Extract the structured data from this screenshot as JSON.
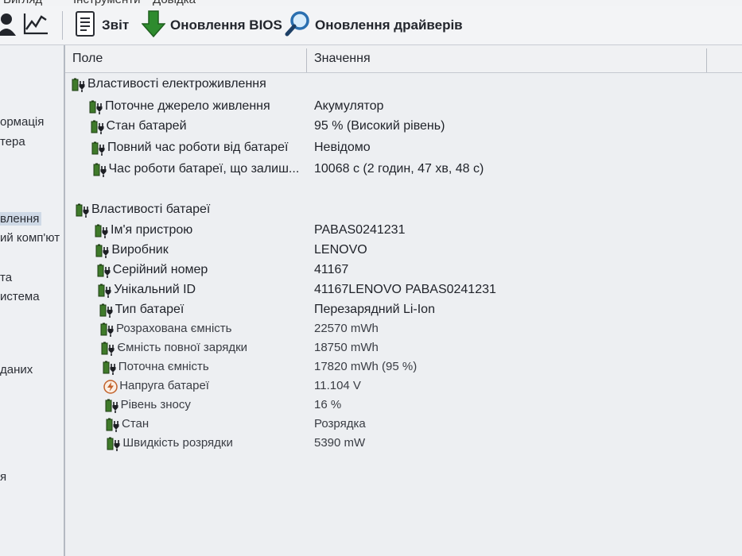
{
  "menu": {
    "items": [
      {
        "label": "Вигляд"
      },
      {
        "label": "Інструменти"
      },
      {
        "label": "Довідка"
      }
    ]
  },
  "toolbar": {
    "report_label": "Звіт",
    "bios_label": "Оновлення BIOS",
    "drivers_label": "Оновлення драйверів"
  },
  "sidebar": {
    "items": [
      {
        "label": "ормація"
      },
      {
        "label": "тера"
      },
      {
        "label": "влення"
      },
      {
        "label": "ий комп'ют"
      },
      {
        "label": "та"
      },
      {
        "label": "истема"
      },
      {
        "label": "даних"
      },
      {
        "label": "я"
      }
    ]
  },
  "columns": {
    "field": "Поле",
    "value": "Значення"
  },
  "power": {
    "title": "Властивості електроживлення",
    "rows": [
      {
        "field": "Поточне джерело живлення",
        "value": "Акумулятор"
      },
      {
        "field": "Стан батарей",
        "value": "95 % (Високий рівень)"
      },
      {
        "field": "Повний час роботи від батареї",
        "value": "Невідомо"
      },
      {
        "field": "Час роботи батареї, що залиш...",
        "value": "10068 с (2 годин, 47 хв, 48 с)"
      }
    ]
  },
  "battery": {
    "title": "Властивості батареї",
    "rows": [
      {
        "field": "Ім'я пристрою",
        "value": "PABAS0241231"
      },
      {
        "field": "Виробник",
        "value": "LENOVO"
      },
      {
        "field": "Серійний номер",
        "value": "41167"
      },
      {
        "field": "Унікальний ID",
        "value": "41167LENOVO PABAS0241231"
      },
      {
        "field": "Тип батареї",
        "value": "Перезарядний Li-Ion"
      },
      {
        "field": "Розрахована ємність",
        "value": "22570 mWh"
      },
      {
        "field": "Ємність повної зарядки",
        "value": "18750 mWh"
      },
      {
        "field": "Поточна ємність",
        "value": "17820 mWh  (95 %)"
      },
      {
        "field": "Напруга батареї",
        "value": "11.104 V"
      },
      {
        "field": "Рівень зносу",
        "value": "16 %"
      },
      {
        "field": "Стан",
        "value": "Розрядка"
      },
      {
        "field": "Швидкість розрядки",
        "value": "5390 mW"
      }
    ]
  },
  "icons": {
    "battery": "battery-plug-icon",
    "voltage": "lightning-icon",
    "report": "document-icon",
    "bios": "green-down-arrow-icon",
    "drivers": "magnifier-icon",
    "user": "user-icon",
    "chart": "line-chart-icon"
  },
  "colors": {
    "battery_green": "#3f7a2a",
    "plug_dark": "#1d1f24",
    "arrow_green": "#2e8b2e",
    "magnifier_blue": "#2a6fb0"
  }
}
